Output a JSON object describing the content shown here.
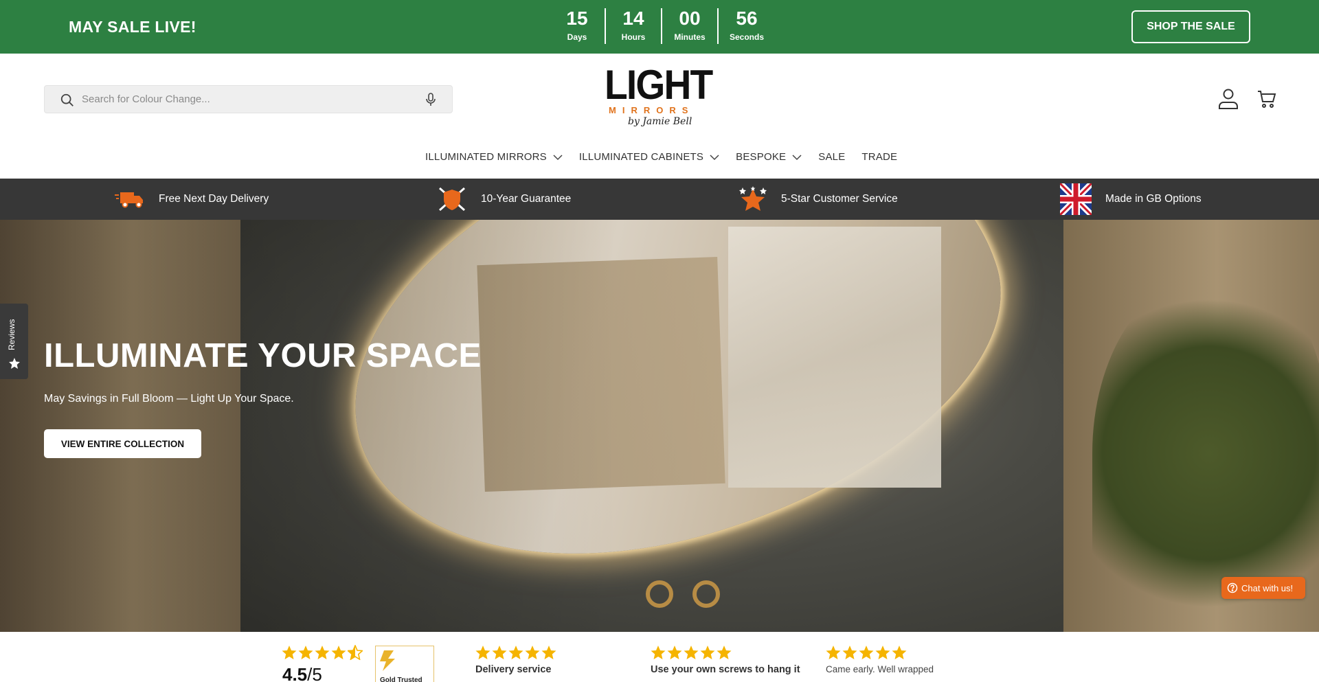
{
  "promo": {
    "title": "MAY SALE LIVE!",
    "countdown": [
      {
        "value": "15",
        "label": "Days"
      },
      {
        "value": "14",
        "label": "Hours"
      },
      {
        "value": "00",
        "label": "Minutes"
      },
      {
        "value": "56",
        "label": "Seconds"
      }
    ],
    "cta": "SHOP THE SALE",
    "bg_color": "#2d8042"
  },
  "header": {
    "search_placeholder": "Search for Colour Change...",
    "logo": {
      "main": "LIGHT",
      "sub": "MIRRORS",
      "by": "by Jamie Bell"
    }
  },
  "nav": {
    "items": [
      {
        "label": "ILLUMINATED MIRRORS",
        "has_dropdown": true
      },
      {
        "label": "ILLUMINATED CABINETS",
        "has_dropdown": true
      },
      {
        "label": "BESPOKE",
        "has_dropdown": true
      },
      {
        "label": "SALE",
        "has_dropdown": false
      },
      {
        "label": "TRADE",
        "has_dropdown": false
      }
    ]
  },
  "features": [
    {
      "icon": "delivery-truck-icon",
      "label": "Free Next Day Delivery"
    },
    {
      "icon": "shield-icon",
      "label": "10-Year Guarantee"
    },
    {
      "icon": "star-badge-icon",
      "label": "5-Star Customer Service"
    },
    {
      "icon": "uk-flag-icon",
      "label": "Made in GB Options"
    }
  ],
  "hero": {
    "title": "ILLUMINATE YOUR SPACE",
    "subtitle": "May Savings in Full Bloom — Light Up Your Space.",
    "cta": "VIEW ENTIRE COLLECTION"
  },
  "reviews_tab": {
    "label": "Reviews"
  },
  "chat": {
    "label": "Chat with us!"
  },
  "reviews_strip": {
    "rating": "4.5",
    "out_of": "/5",
    "badge_text": "Gold Trusted",
    "items": [
      {
        "stars": 5,
        "title": "Delivery service"
      },
      {
        "stars": 5,
        "title": "Use your own screws to hang it"
      },
      {
        "stars": 5,
        "title": "Came early. Well wrapped"
      }
    ]
  },
  "colors": {
    "accent_orange": "#e8681c",
    "star_yellow": "#f5b400",
    "features_bg": "#373737"
  }
}
